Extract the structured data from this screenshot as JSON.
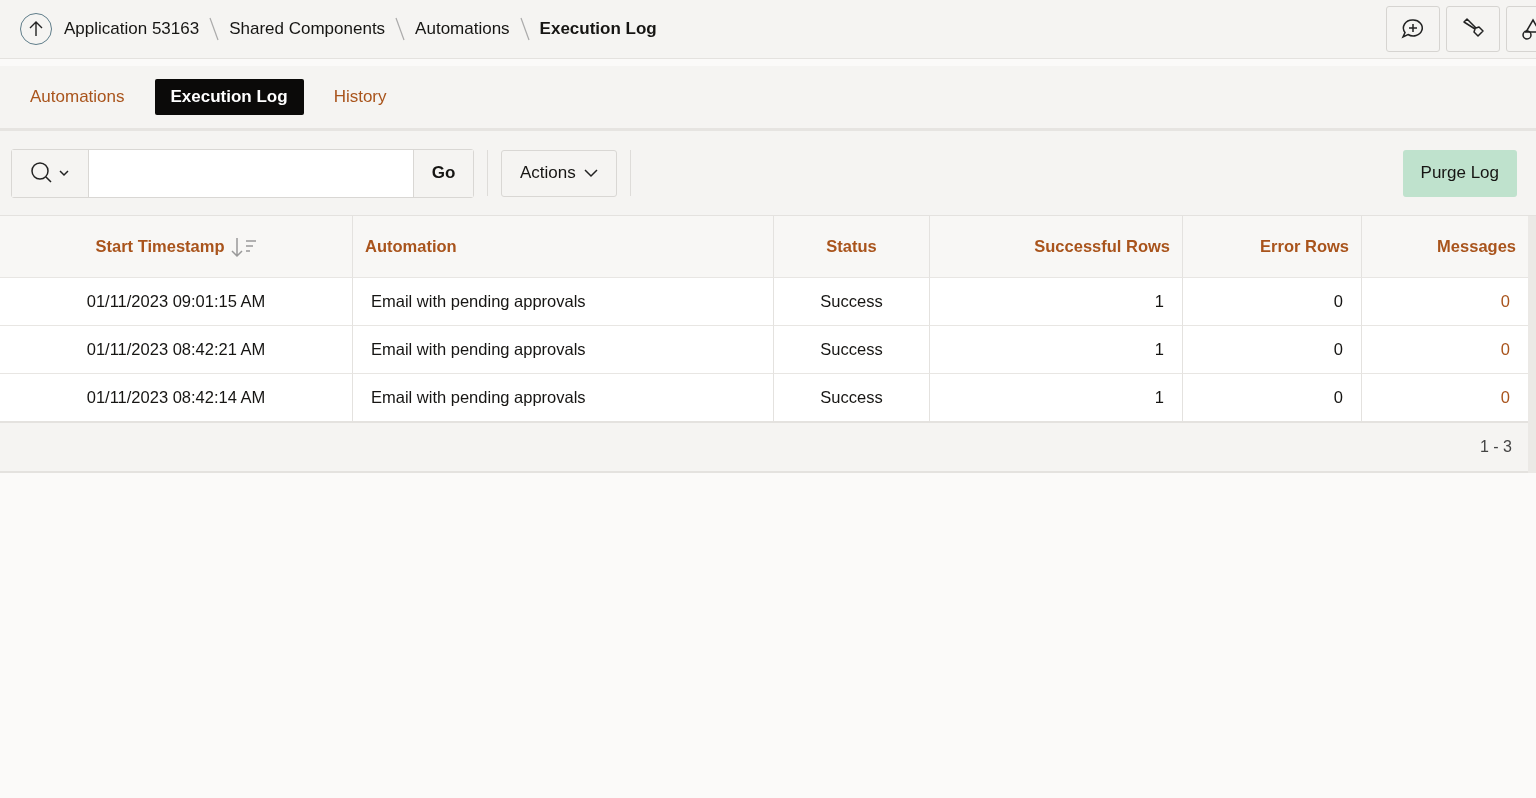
{
  "breadcrumb": [
    {
      "label": "Application 53163",
      "current": false
    },
    {
      "label": "Shared Components",
      "current": false
    },
    {
      "label": "Automations",
      "current": false
    },
    {
      "label": "Execution Log",
      "current": true
    }
  ],
  "tabs": [
    {
      "label": "Automations",
      "selected": false
    },
    {
      "label": "Execution Log",
      "selected": true
    },
    {
      "label": "History",
      "selected": false
    }
  ],
  "toolbar": {
    "go": "Go",
    "actions": "Actions",
    "purge": "Purge Log"
  },
  "table": {
    "columns": [
      {
        "label": "Start Timestamp",
        "sorted": true
      },
      {
        "label": "Automation",
        "sorted": false
      },
      {
        "label": "Status",
        "sorted": false
      },
      {
        "label": "Successful Rows",
        "sorted": false
      },
      {
        "label": "Error Rows",
        "sorted": false
      },
      {
        "label": "Messages",
        "sorted": false
      }
    ],
    "rows": [
      [
        "01/11/2023 09:01:15 AM",
        "Email with pending approvals",
        "Success",
        "1",
        "0",
        "0"
      ],
      [
        "01/11/2023 08:42:21 AM",
        "Email with pending approvals",
        "Success",
        "1",
        "0",
        "0"
      ],
      [
        "01/11/2023 08:42:14 AM",
        "Email with pending approvals",
        "Success",
        "1",
        "0",
        "0"
      ]
    ],
    "pagination": "1 - 3"
  }
}
